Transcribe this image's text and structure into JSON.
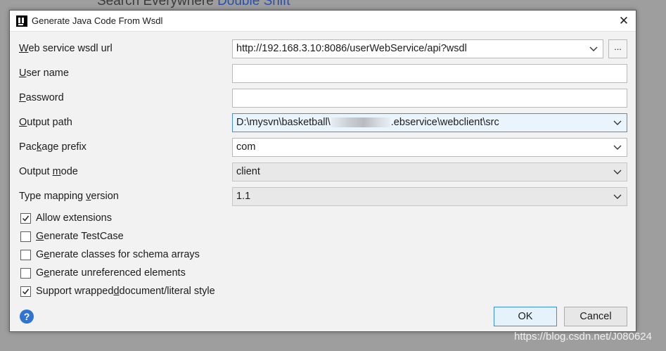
{
  "background": {
    "hint_text": "Search Everywhere",
    "hint_shortcut": "Double Shift"
  },
  "dialog": {
    "title": "Generate Java Code From Wsdl",
    "close_label": "✕"
  },
  "fields": {
    "wsdl_url": {
      "label": "Web service wsdl url",
      "value": "http://192.168.3.10:8086/userWebService/api?wsdl"
    },
    "user_name": {
      "label": "User name",
      "value": ""
    },
    "password": {
      "label": "Password",
      "value": ""
    },
    "output_path": {
      "label": "Output path",
      "value_prefix": "D:\\mysvn\\basketball\\",
      "value_suffix": ".ebservice\\webclient\\src"
    },
    "package_prefix": {
      "label": "Package prefix",
      "value": "com"
    },
    "output_mode": {
      "label": "Output mode",
      "value": "client"
    },
    "type_mapping_version": {
      "label": "Type mapping version",
      "value": "1.1"
    },
    "browse_label": "..."
  },
  "checkboxes": [
    {
      "label": "Allow extensions",
      "checked": true
    },
    {
      "label": "Generate TestCase",
      "checked": false
    },
    {
      "label": "Generate classes for schema arrays",
      "checked": false
    },
    {
      "label": "Generate unreferenced elements",
      "checked": false
    },
    {
      "label": "Support wrapped document/literal style",
      "checked": true
    }
  ],
  "buttons": {
    "help": "?",
    "ok": "OK",
    "cancel": "Cancel"
  },
  "watermark": "https://blog.csdn.net/J080624",
  "colors": {
    "accent": "#3c8ee5",
    "help_icon": "#2f74d0",
    "focused_field": "#e9f4fd"
  }
}
